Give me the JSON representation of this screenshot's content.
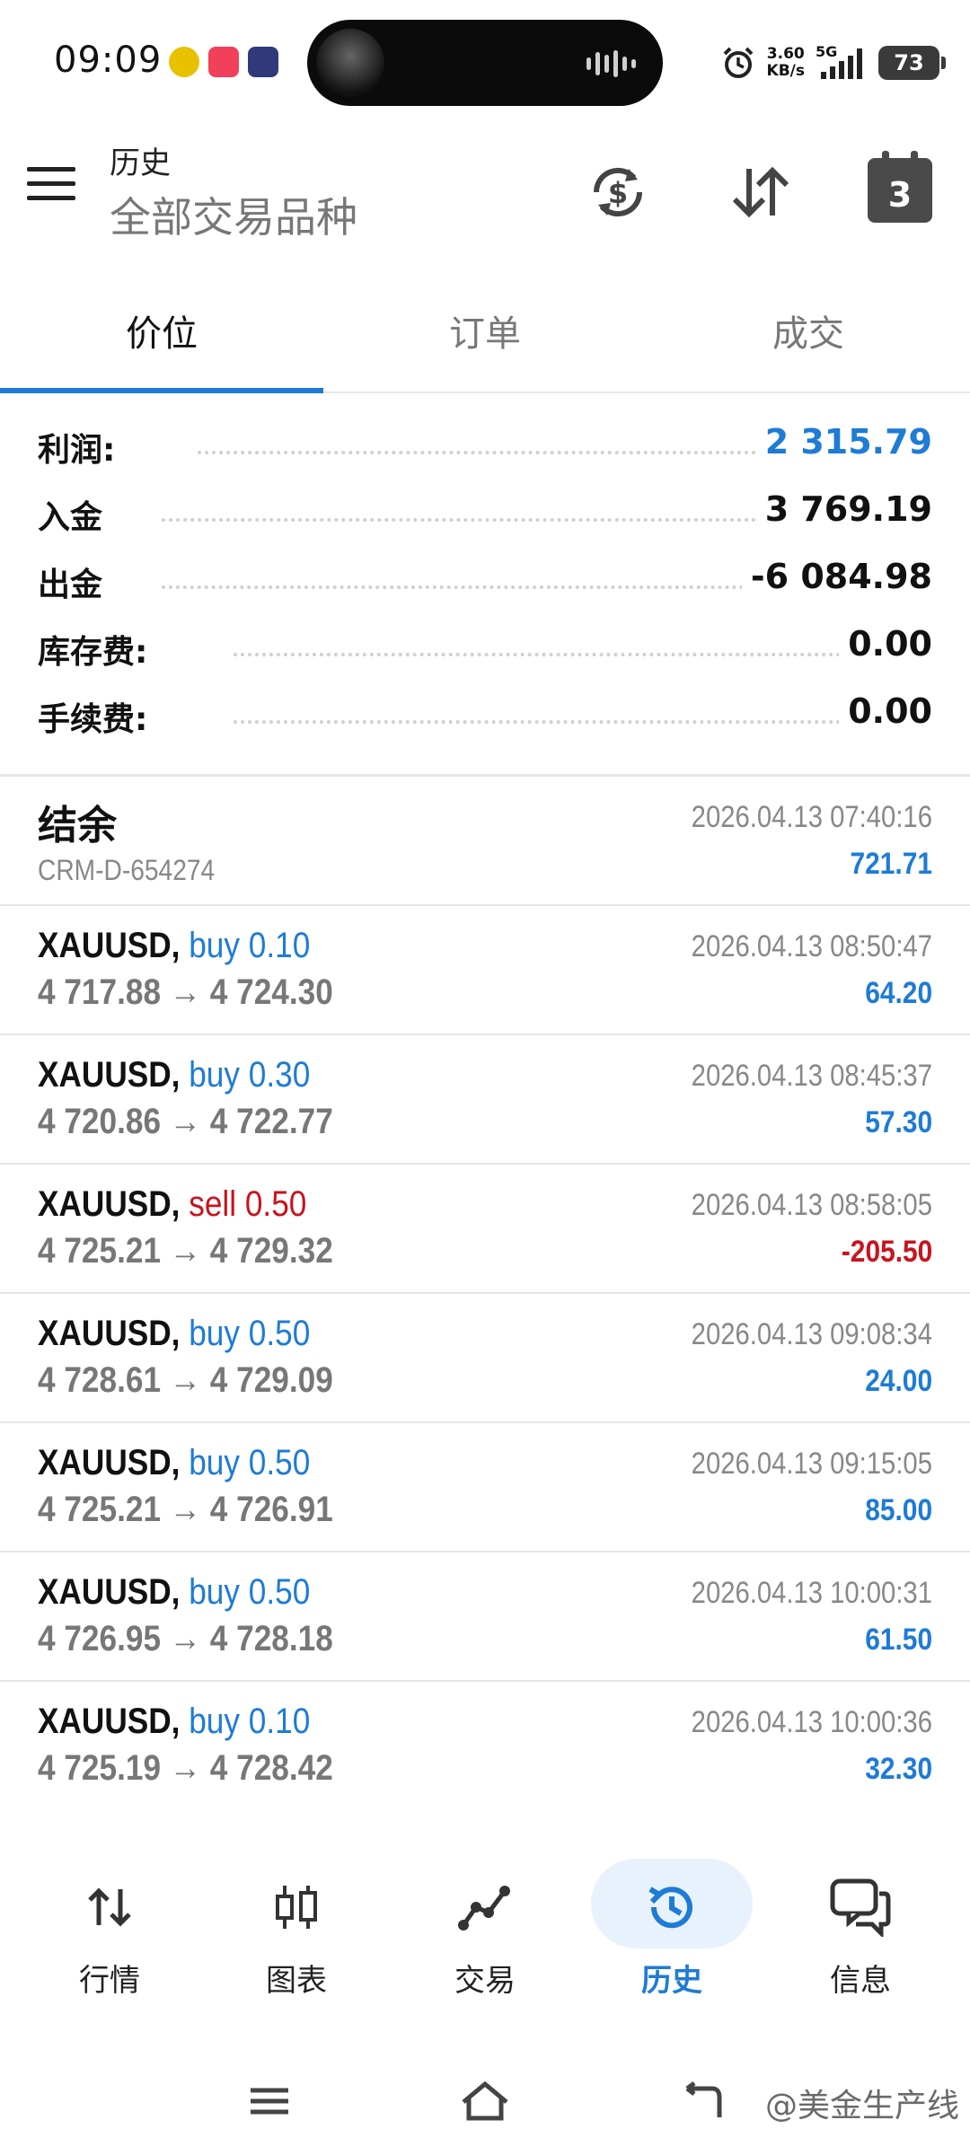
{
  "status_bar": {
    "time": "09:09",
    "net_speed_value": "3.60",
    "net_speed_unit": "KB/s",
    "network": "5G",
    "battery": "73"
  },
  "header": {
    "subtitle": "历史",
    "title": "全部交易品种",
    "calendar_day": "3"
  },
  "tabs": [
    {
      "label": "价位",
      "active": true
    },
    {
      "label": "订单",
      "active": false
    },
    {
      "label": "成交",
      "active": false
    }
  ],
  "summary": [
    {
      "label": "利润:",
      "value": "2 315.79"
    },
    {
      "label": "入金",
      "value": "3 769.19"
    },
    {
      "label": "出金",
      "value": "-6 084.98"
    },
    {
      "label": "库存费:",
      "value": "0.00"
    },
    {
      "label": "手续费:",
      "value": "0.00"
    }
  ],
  "balance": {
    "title": "结余",
    "id": "CRM-D-654274",
    "time": "2026.04.13 07:40:16",
    "amount": "721.71"
  },
  "trades": [
    {
      "symbol": "XAUUSD,",
      "side": "buy",
      "volume": "0.10",
      "open": "4 717.88",
      "close": "4 724.30",
      "time": "2026.04.13 08:50:47",
      "profit": "64.20"
    },
    {
      "symbol": "XAUUSD,",
      "side": "buy",
      "volume": "0.30",
      "open": "4 720.86",
      "close": "4 722.77",
      "time": "2026.04.13 08:45:37",
      "profit": "57.30"
    },
    {
      "symbol": "XAUUSD,",
      "side": "sell",
      "volume": "0.50",
      "open": "4 725.21",
      "close": "4 729.32",
      "time": "2026.04.13 08:58:05",
      "profit": "-205.50"
    },
    {
      "symbol": "XAUUSD,",
      "side": "buy",
      "volume": "0.50",
      "open": "4 728.61",
      "close": "4 729.09",
      "time": "2026.04.13 09:08:34",
      "profit": "24.00"
    },
    {
      "symbol": "XAUUSD,",
      "side": "buy",
      "volume": "0.50",
      "open": "4 725.21",
      "close": "4 726.91",
      "time": "2026.04.13 09:15:05",
      "profit": "85.00"
    },
    {
      "symbol": "XAUUSD,",
      "side": "buy",
      "volume": "0.50",
      "open": "4 726.95",
      "close": "4 728.18",
      "time": "2026.04.13 10:00:31",
      "profit": "61.50"
    },
    {
      "symbol": "XAUUSD,",
      "side": "buy",
      "volume": "0.10",
      "open": "4 725.19",
      "close": "4 728.42",
      "time": "2026.04.13 10:00:36",
      "profit": "32.30"
    }
  ],
  "bottom_nav": [
    {
      "label": "行情",
      "icon": "quotes-arrows-icon",
      "active": false
    },
    {
      "label": "图表",
      "icon": "candlestick-chart-icon",
      "active": false
    },
    {
      "label": "交易",
      "icon": "trade-line-icon",
      "active": false
    },
    {
      "label": "历史",
      "icon": "history-clock-icon",
      "active": true
    },
    {
      "label": "信息",
      "icon": "messages-icon",
      "active": false
    }
  ],
  "watermark": "@美金生产线",
  "colors": {
    "accent": "#1e7bd6",
    "loss": "#c8141e",
    "muted": "#777777"
  }
}
